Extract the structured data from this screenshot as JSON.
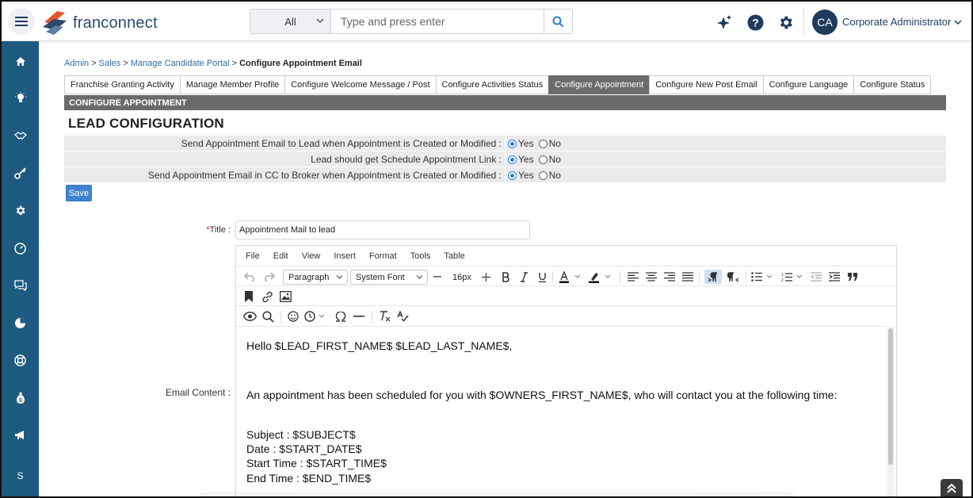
{
  "header": {
    "logo_text": "franconnect",
    "search": {
      "scope": "All",
      "placeholder": "Type and press enter"
    },
    "user": {
      "initials": "CA",
      "name": "Corporate Administrator"
    }
  },
  "sidebar": {
    "items": [
      {
        "icon": "home-icon"
      },
      {
        "icon": "lightbulb-icon"
      },
      {
        "icon": "handshake-icon"
      },
      {
        "icon": "key-icon"
      },
      {
        "icon": "gear-icon"
      },
      {
        "icon": "gauge-icon"
      },
      {
        "icon": "chat-icon"
      },
      {
        "icon": "pie-icon"
      },
      {
        "icon": "lifebuoy-icon"
      },
      {
        "icon": "money-bag-icon"
      },
      {
        "icon": "megaphone-icon"
      }
    ],
    "bottom_letter": "S"
  },
  "breadcrumb": {
    "items": [
      "Admin",
      "Sales",
      "Manage Candidate Portal"
    ],
    "sep": " > ",
    "current": "Configure Appointment Email"
  },
  "tabs": [
    {
      "label": "Franchise Granting Activity"
    },
    {
      "label": "Manage Member Profile"
    },
    {
      "label": "Configure Welcome Message / Post"
    },
    {
      "label": "Configure Activities Status"
    },
    {
      "label": "Configure Appointment",
      "active": true
    },
    {
      "label": "Configure New Post Email"
    },
    {
      "label": "Configure Language"
    },
    {
      "label": "Configure Status"
    }
  ],
  "section_title": "CONFIGURE APPOINTMENT",
  "lead_config": {
    "title": "LEAD CONFIGURATION",
    "rows": [
      {
        "label": "Send Appointment Email to Lead when Appointment is Created or Modified :",
        "yes": "Yes",
        "no": "No",
        "selected": "yes"
      },
      {
        "label": "Lead should get Schedule Appointment Link :",
        "yes": "Yes",
        "no": "No",
        "selected": "yes"
      },
      {
        "label": "Send Appointment Email in CC to Broker when Appointment is Created or Modified :",
        "yes": "Yes",
        "no": "No",
        "selected": "yes"
      }
    ],
    "save_label": "Save"
  },
  "form": {
    "title_required": "*",
    "title_label": "Title :",
    "title_value": "Appointment Mail to lead",
    "email_label": "Email Content :"
  },
  "editor": {
    "menu": [
      "File",
      "Edit",
      "View",
      "Insert",
      "Format",
      "Tools",
      "Table"
    ],
    "block_format": "Paragraph",
    "font_family": "System Font",
    "font_size": "16px",
    "content": [
      "Hello $LEAD_FIRST_NAME$ $LEAD_LAST_NAME$,",
      "An appointment has been scheduled for you with $OWNERS_FIRST_NAME$, who will contact you at the following time:",
      "Subject : $SUBJECT$",
      "Date : $START_DATE$",
      "Start Time : $START_TIME$",
      "End Time : $END_TIME$"
    ]
  },
  "colors": {
    "sidebar": "#1e5a80",
    "accent": "#3f83cf",
    "section_bar": "#6b6b6b"
  }
}
